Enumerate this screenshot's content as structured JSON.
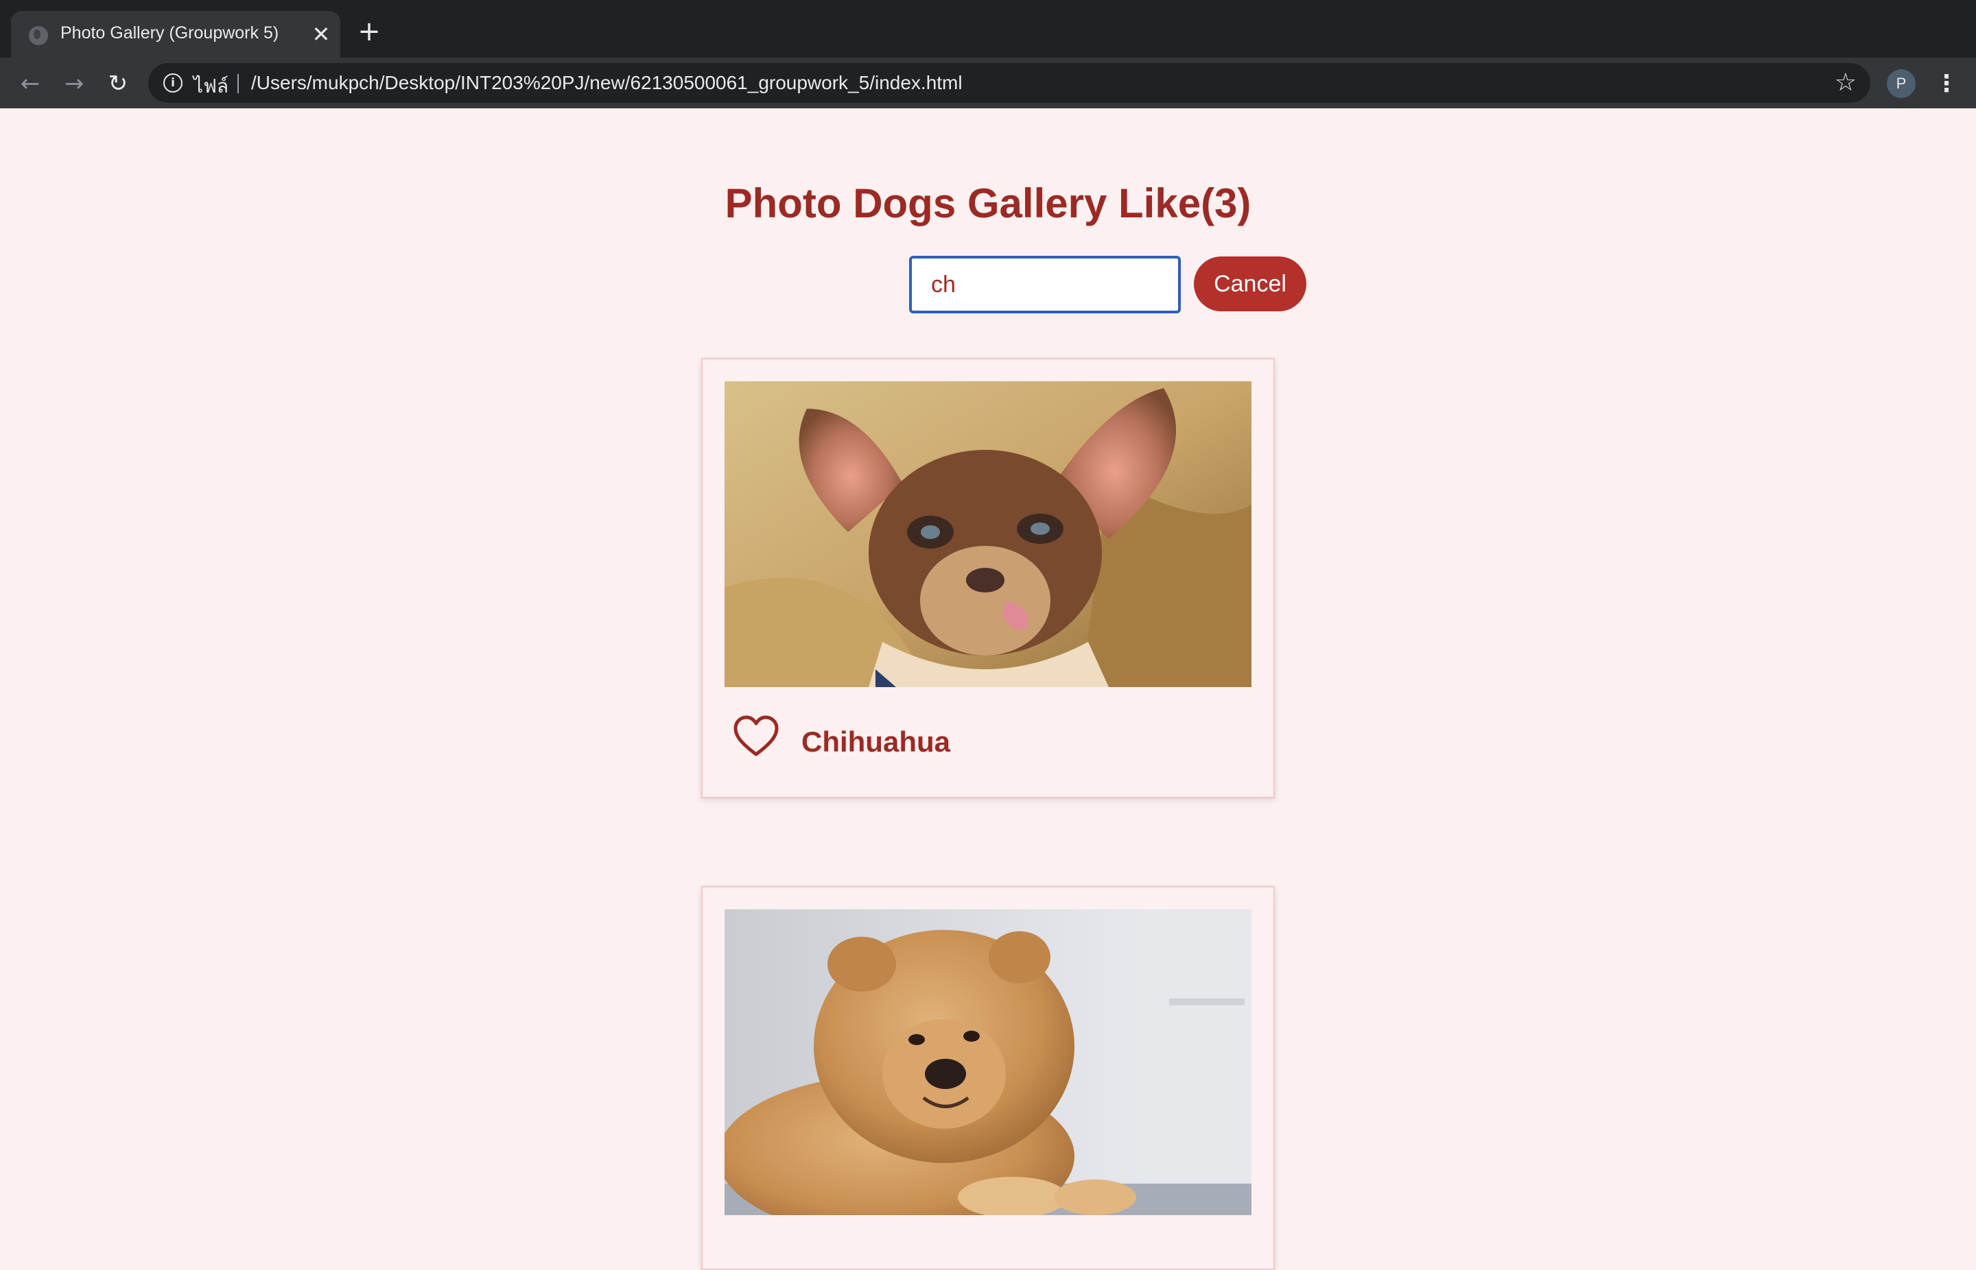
{
  "browser": {
    "tab_title": "Photo Gallery (Groupwork 5)",
    "tab_close": "✕",
    "new_tab": "+",
    "scheme_label": "ไฟล์",
    "url": "/Users/mukpch/Desktop/INT203%20PJ/new/62130500061_groupwork_5/index.html",
    "profile_initial": "P"
  },
  "page": {
    "title": "Photo Dogs Gallery Like(3)",
    "search": {
      "value": "ch"
    },
    "cancel_label": "Cancel",
    "accent_color": "#9b2a25",
    "button_color": "#b3302b",
    "background_color": "#fcf0f0"
  },
  "cards": [
    {
      "name": "Chihuahua",
      "liked": false,
      "icon": "heart-outline-icon"
    },
    {
      "name": "",
      "liked": false,
      "icon": "heart-outline-icon"
    }
  ]
}
